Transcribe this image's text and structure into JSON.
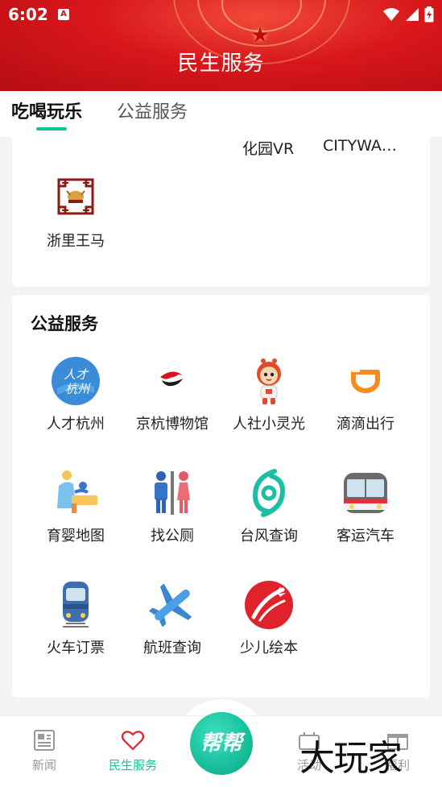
{
  "status_bar": {
    "time": "6:02",
    "notification_badge": "A"
  },
  "header": {
    "title": "民生服务"
  },
  "tabs": [
    {
      "label": "吃喝玩乐",
      "active": true
    },
    {
      "label": "公益服务",
      "active": false
    }
  ],
  "top_card": {
    "partial_items": [
      {
        "label": "化园VR"
      },
      {
        "label": "CITYWA…"
      }
    ],
    "items": [
      {
        "label": "浙里王马",
        "icon": "horse-pattern-icon"
      }
    ]
  },
  "public_services": {
    "title": "公益服务",
    "items": [
      {
        "label": "人才杭州",
        "icon": "rencai-hangzhou-icon",
        "icon_text": "人才\n杭州"
      },
      {
        "label": "京杭博物馆",
        "icon": "museum-wave-icon"
      },
      {
        "label": "人社小灵光",
        "icon": "mascot-icon"
      },
      {
        "label": "滴滴出行",
        "icon": "didi-icon"
      },
      {
        "label": "育婴地图",
        "icon": "parent-baby-icon"
      },
      {
        "label": "找公厕",
        "icon": "restroom-icon"
      },
      {
        "label": "台风查询",
        "icon": "typhoon-icon"
      },
      {
        "label": "客运汽车",
        "icon": "bus-icon"
      },
      {
        "label": "火车订票",
        "icon": "train-icon"
      },
      {
        "label": "航班查询",
        "icon": "airplane-icon"
      },
      {
        "label": "少儿绘本",
        "icon": "kids-book-icon"
      }
    ]
  },
  "bottom_nav": {
    "items": [
      {
        "label": "新闻",
        "icon": "news-icon",
        "active": false
      },
      {
        "label": "民生服务",
        "icon": "heart-icon",
        "active": true
      },
      {
        "label": "活动",
        "icon": "activity-icon",
        "active": false
      },
      {
        "label": "福利",
        "icon": "gift-icon",
        "active": false
      }
    ],
    "center_button": {
      "label": "帮帮"
    }
  },
  "watermark": {
    "text": "大玩家"
  },
  "colors": {
    "accent": "#18c29c",
    "header_red": "#d8171b"
  }
}
